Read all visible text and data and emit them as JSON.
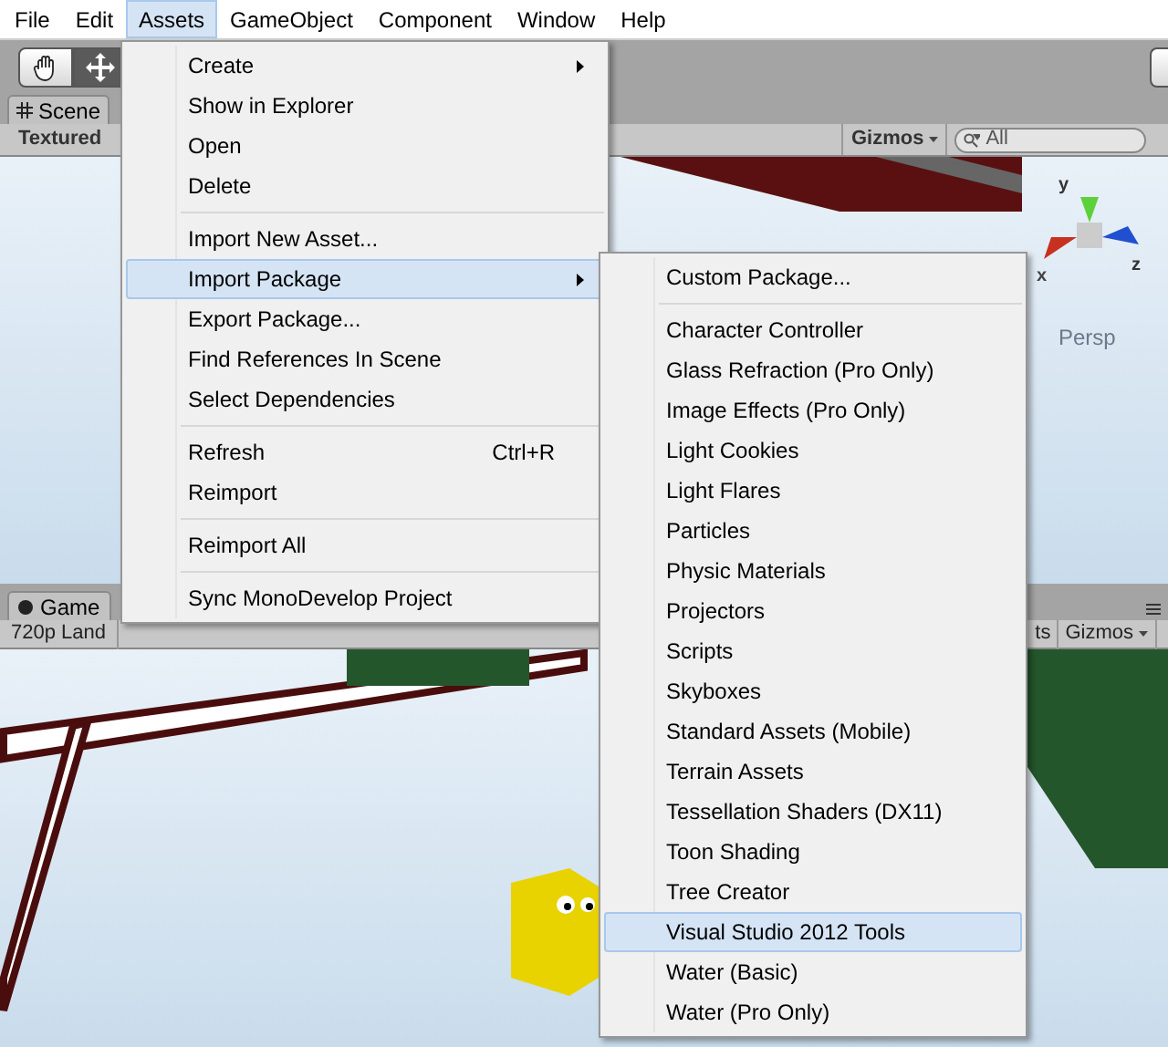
{
  "menu_bar": [
    {
      "label": "File",
      "selected": false
    },
    {
      "label": "Edit",
      "selected": false
    },
    {
      "label": "Assets",
      "selected": true
    },
    {
      "label": "GameObject",
      "selected": false
    },
    {
      "label": "Component",
      "selected": false
    },
    {
      "label": "Window",
      "selected": false
    },
    {
      "label": "Help",
      "selected": false
    }
  ],
  "toolbar": {
    "tools": [
      {
        "kind": "hand",
        "selected": false
      },
      {
        "kind": "move",
        "selected": true
      }
    ]
  },
  "scene_panel": {
    "tab": "Scene",
    "render_mode": "Textured",
    "gizmos": "Gizmos",
    "search": {
      "placeholder": "All"
    },
    "axis_labels": [
      "y",
      "z",
      "x"
    ],
    "projection": "Persp"
  },
  "game_panel": {
    "tab": "Game",
    "aspect": "720p Land",
    "stats": "ts",
    "gizmos": "Gizmos"
  },
  "assets_menu": [
    {
      "kind": "item",
      "label": "Create",
      "submenu": true,
      "selected": false
    },
    {
      "kind": "item",
      "label": "Show in Explorer",
      "selected": false
    },
    {
      "kind": "item",
      "label": "Open",
      "selected": false
    },
    {
      "kind": "item",
      "label": "Delete",
      "selected": false
    },
    {
      "kind": "separator"
    },
    {
      "kind": "item",
      "label": "Import New Asset...",
      "selected": false
    },
    {
      "kind": "item",
      "label": "Import Package",
      "submenu": true,
      "selected": true
    },
    {
      "kind": "item",
      "label": "Export Package...",
      "selected": false
    },
    {
      "kind": "item",
      "label": "Find References In Scene",
      "selected": false
    },
    {
      "kind": "item",
      "label": "Select Dependencies",
      "selected": false
    },
    {
      "kind": "separator"
    },
    {
      "kind": "item",
      "label": "Refresh",
      "shortcut": "Ctrl+R",
      "selected": false
    },
    {
      "kind": "item",
      "label": "Reimport",
      "selected": false
    },
    {
      "kind": "separator"
    },
    {
      "kind": "item",
      "label": "Reimport All",
      "selected": false
    },
    {
      "kind": "separator"
    },
    {
      "kind": "item",
      "label": "Sync MonoDevelop Project",
      "selected": false
    }
  ],
  "import_package_menu": [
    {
      "kind": "item",
      "label": "Custom Package...",
      "selected": false
    },
    {
      "kind": "separator"
    },
    {
      "kind": "item",
      "label": "Character Controller",
      "selected": false
    },
    {
      "kind": "item",
      "label": "Glass Refraction (Pro Only)",
      "selected": false
    },
    {
      "kind": "item",
      "label": "Image Effects (Pro Only)",
      "selected": false
    },
    {
      "kind": "item",
      "label": "Light Cookies",
      "selected": false
    },
    {
      "kind": "item",
      "label": "Light Flares",
      "selected": false
    },
    {
      "kind": "item",
      "label": "Particles",
      "selected": false
    },
    {
      "kind": "item",
      "label": "Physic Materials",
      "selected": false
    },
    {
      "kind": "item",
      "label": "Projectors",
      "selected": false
    },
    {
      "kind": "item",
      "label": "Scripts",
      "selected": false
    },
    {
      "kind": "item",
      "label": "Skyboxes",
      "selected": false
    },
    {
      "kind": "item",
      "label": "Standard Assets (Mobile)",
      "selected": false
    },
    {
      "kind": "item",
      "label": "Terrain Assets",
      "selected": false
    },
    {
      "kind": "item",
      "label": "Tessellation Shaders (DX11)",
      "selected": false
    },
    {
      "kind": "item",
      "label": "Toon Shading",
      "selected": false
    },
    {
      "kind": "item",
      "label": "Tree Creator",
      "selected": false
    },
    {
      "kind": "item",
      "label": "Visual Studio 2012 Tools",
      "selected": true
    },
    {
      "kind": "item",
      "label": "Water (Basic)",
      "selected": false
    },
    {
      "kind": "item",
      "label": "Water (Pro Only)",
      "selected": false
    }
  ]
}
